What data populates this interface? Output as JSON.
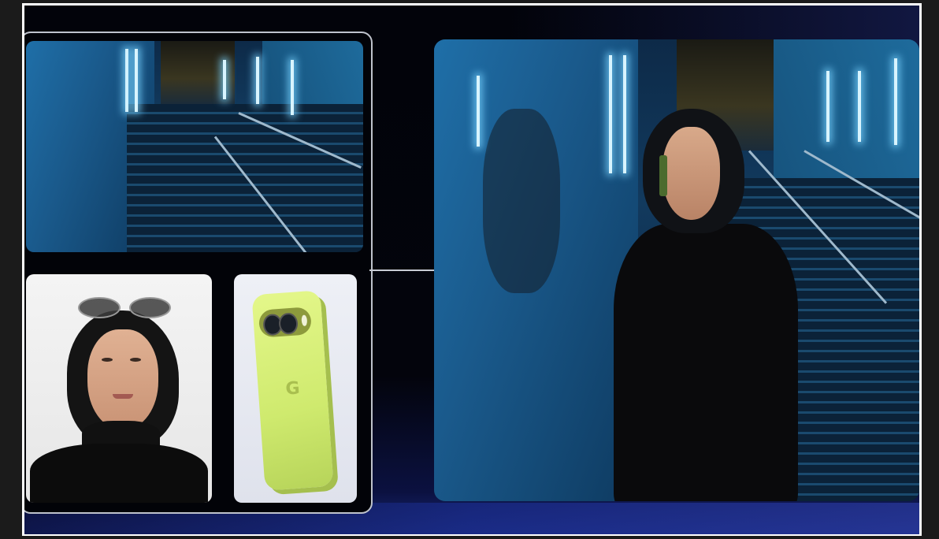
{
  "phone": {
    "logo_glyph": "G"
  }
}
